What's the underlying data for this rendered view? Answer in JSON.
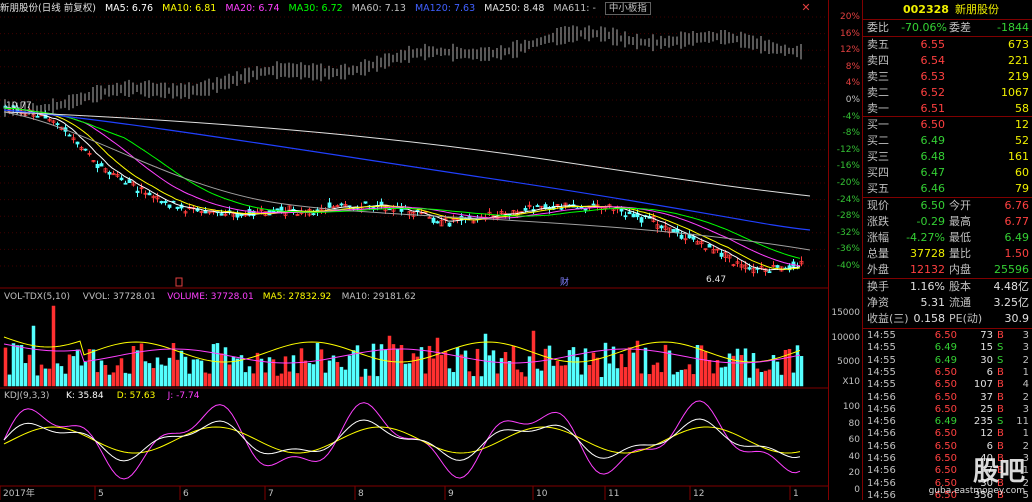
{
  "header": {
    "title": "新朋股份(日线 前复权)",
    "ma5": "MA5: 6.76",
    "ma10": "MA10: 6.81",
    "ma20": "MA20: 6.74",
    "ma30": "MA30: 6.72",
    "ma60": "MA60: 7.13",
    "ma120": "MA120: 7.63",
    "ma250": "MA250: 8.48",
    "ma611": "MA611: -",
    "board": "中小板指"
  },
  "main_labels": {
    "high": "10.77",
    "low": "6.47",
    "event": "财"
  },
  "pct_scale": [
    "20%",
    "16%",
    "12%",
    "8%",
    "4%",
    "0%",
    "-4%",
    "-8%",
    "-12%",
    "-16%",
    "-20%",
    "-24%",
    "-28%",
    "-32%",
    "-36%",
    "-40%"
  ],
  "vol_header": {
    "name": "VOL-TDX(5,10)",
    "vvol": "VVOL: 37728.01",
    "volume": "VOLUME: 37728.01",
    "ma5": "MA5: 27832.92",
    "ma10": "MA10: 29181.62"
  },
  "vol_scale": [
    "15000",
    "10000",
    "5000",
    "X10"
  ],
  "kdj_header": {
    "name": "KDJ(9,3,3)",
    "k": "K: 35.84",
    "d": "D: 57.63",
    "j": "J: -7.74"
  },
  "kdj_scale": [
    "100.00",
    "80.00",
    "60.00",
    "40.00",
    "20.00",
    "0.00"
  ],
  "x_axis": [
    "2017年",
    "5",
    "6",
    "7",
    "8",
    "9",
    "10",
    "11",
    "12",
    "1"
  ],
  "period": "日线",
  "side": {
    "code": "002328",
    "name": "新朋股份",
    "webi": {
      "label": "委比",
      "value": "-70.06%",
      "label2": "委差",
      "value2": "-1844"
    },
    "asks": [
      {
        "label": "卖五",
        "price": "6.55",
        "vol": "673"
      },
      {
        "label": "卖四",
        "price": "6.54",
        "vol": "221"
      },
      {
        "label": "卖三",
        "price": "6.53",
        "vol": "219"
      },
      {
        "label": "卖二",
        "price": "6.52",
        "vol": "1067"
      },
      {
        "label": "卖一",
        "price": "6.51",
        "vol": "58"
      }
    ],
    "bids": [
      {
        "label": "买一",
        "price": "6.50",
        "vol": "12"
      },
      {
        "label": "买二",
        "price": "6.49",
        "vol": "52"
      },
      {
        "label": "买三",
        "price": "6.48",
        "vol": "161"
      },
      {
        "label": "买四",
        "price": "6.47",
        "vol": "60"
      },
      {
        "label": "买五",
        "price": "6.46",
        "vol": "79"
      }
    ],
    "quote": [
      {
        "l1": "现价",
        "v1": "6.50",
        "c1": "green",
        "l2": "今开",
        "v2": "6.76",
        "c2": "red"
      },
      {
        "l1": "涨跌",
        "v1": "-0.29",
        "c1": "green",
        "l2": "最高",
        "v2": "6.77",
        "c2": "red"
      },
      {
        "l1": "涨幅",
        "v1": "-4.27%",
        "c1": "green",
        "l2": "最低",
        "v2": "6.49",
        "c2": "green"
      },
      {
        "l1": "总量",
        "v1": "37728",
        "c1": "yel",
        "l2": "量比",
        "v2": "1.50",
        "c2": "red"
      },
      {
        "l1": "外盘",
        "v1": "12132",
        "c1": "red",
        "l2": "内盘",
        "v2": "25596",
        "c2": "green"
      }
    ],
    "stats": [
      {
        "l1": "换手",
        "v1": "1.16%",
        "l2": "股本",
        "v2": "4.48亿"
      },
      {
        "l1": "净资",
        "v1": "5.31",
        "l2": "流通",
        "v2": "3.25亿"
      },
      {
        "l1": "收益(三)",
        "v1": "0.158",
        "l2": "PE(动)",
        "v2": "30.9"
      }
    ],
    "ticks": [
      {
        "t": "14:55",
        "p": "6.50",
        "q": "73",
        "b": "B",
        "bc": "red",
        "n": "3"
      },
      {
        "t": "14:55",
        "p": "6.49",
        "q": "15",
        "b": "S",
        "bc": "green",
        "n": "3"
      },
      {
        "t": "14:55",
        "p": "6.49",
        "q": "30",
        "b": "S",
        "bc": "green",
        "n": "2"
      },
      {
        "t": "14:55",
        "p": "6.50",
        "q": "6",
        "b": "B",
        "bc": "red",
        "n": "1"
      },
      {
        "t": "14:55",
        "p": "6.50",
        "q": "107",
        "b": "B",
        "bc": "red",
        "n": "4"
      },
      {
        "t": "14:56",
        "p": "6.50",
        "q": "37",
        "b": "B",
        "bc": "red",
        "n": "2"
      },
      {
        "t": "14:56",
        "p": "6.50",
        "q": "25",
        "b": "B",
        "bc": "red",
        "n": "3"
      },
      {
        "t": "14:56",
        "p": "6.49",
        "q": "235",
        "b": "S",
        "bc": "green",
        "n": "11"
      },
      {
        "t": "14:56",
        "p": "6.50",
        "q": "12",
        "b": "B",
        "bc": "red",
        "n": "1"
      },
      {
        "t": "14:56",
        "p": "6.50",
        "q": "6",
        "b": "B",
        "bc": "red",
        "n": "2"
      },
      {
        "t": "14:56",
        "p": "6.50",
        "q": "40",
        "b": "B",
        "bc": "red",
        "n": "3"
      },
      {
        "t": "14:56",
        "p": "6.50",
        "q": "7",
        "b": "B",
        "bc": "red",
        "n": "1"
      },
      {
        "t": "14:56",
        "p": "6.50",
        "q": "30",
        "b": "B",
        "bc": "red",
        "n": "2"
      },
      {
        "t": "14:56",
        "p": "6.50",
        "q": "356",
        "b": "B",
        "bc": "red",
        "n": "5"
      }
    ]
  },
  "watermark": {
    "logo": "股吧",
    "url": "guba.eastmoney.com"
  },
  "colors": {
    "up": "#ff3c3c",
    "down": "#54ffff",
    "ma5": "#ffffff",
    "ma10": "#ffff00",
    "ma20": "#ff40ff",
    "ma30": "#00ff00",
    "ma120": "#2040ff",
    "ma250": "#e0e0e0",
    "grid": "#800000"
  }
}
